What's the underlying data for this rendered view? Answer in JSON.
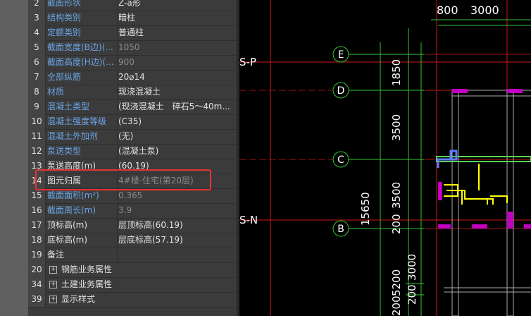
{
  "properties": [
    {
      "num": "2",
      "name": "截面形状",
      "value": "Z-a形",
      "name_blue": true,
      "value_gray": false
    },
    {
      "num": "3",
      "name": "结构类别",
      "value": "暗柱",
      "name_blue": true,
      "value_gray": false
    },
    {
      "num": "4",
      "name": "定额类别",
      "value": "普通柱",
      "name_blue": true,
      "value_gray": false
    },
    {
      "num": "5",
      "name": "截面宽度(B边)(...",
      "value": "1050",
      "name_blue": true,
      "value_gray": true
    },
    {
      "num": "6",
      "name": "截面高度(H边)(...",
      "value": "900",
      "name_blue": true,
      "value_gray": true
    },
    {
      "num": "7",
      "name": "全部纵筋",
      "value": "20⌀14",
      "name_blue": true,
      "value_gray": false
    },
    {
      "num": "8",
      "name": "材质",
      "value": "现浇混凝土",
      "name_blue": true,
      "value_gray": false
    },
    {
      "num": "9",
      "name": "混凝土类型",
      "value": "(现浇混凝土　碎石5～40m...",
      "name_blue": true,
      "value_gray": false
    },
    {
      "num": "10",
      "name": "混凝土强度等级",
      "value": "(C35)",
      "name_blue": true,
      "value_gray": false
    },
    {
      "num": "11",
      "name": "混凝土外加剂",
      "value": "(无)",
      "name_blue": true,
      "value_gray": false
    },
    {
      "num": "12",
      "name": "泵送类型",
      "value": "(混凝土泵)",
      "name_blue": true,
      "value_gray": false
    },
    {
      "num": "13",
      "name": "泵送高度(m)",
      "value": "(60.19)",
      "name_blue": false,
      "value_gray": false
    },
    {
      "num": "14",
      "name": "图元归属",
      "value": "4#楼-住宅(第20层)",
      "name_blue": false,
      "value_gray": true
    },
    {
      "num": "15",
      "name": "截面面积(m²)",
      "value": "0.365",
      "name_blue": true,
      "value_gray": true
    },
    {
      "num": "16",
      "name": "截面周长(m)",
      "value": "3.9",
      "name_blue": true,
      "value_gray": true
    },
    {
      "num": "17",
      "name": "顶标高(m)",
      "value": "层顶标高(60.19)",
      "name_blue": false,
      "value_gray": false
    },
    {
      "num": "18",
      "name": "底标高(m)",
      "value": "层底标高(57.19)",
      "name_blue": false,
      "value_gray": false
    },
    {
      "num": "19",
      "name": "备注",
      "value": "",
      "name_blue": false,
      "value_gray": false
    }
  ],
  "groups": [
    {
      "num": "20",
      "label": "钢筋业务属性"
    },
    {
      "num": "34",
      "label": "土建业务属性"
    },
    {
      "num": "39",
      "label": "显示样式"
    }
  ],
  "cad": {
    "top_dims": [
      "800",
      "3000"
    ],
    "axis_labels": {
      "E": "E",
      "D": "D",
      "C": "C",
      "B": "B"
    },
    "section_labels": {
      "sp": "S-P",
      "sn": "S-N"
    },
    "vert_dims": {
      "d1850": "1850",
      "d3500a": "3500",
      "d3500b": "3500",
      "d200a": "200",
      "d15650": "15650",
      "d5200": "5200",
      "d3000": "3000",
      "d200b": "200"
    }
  }
}
